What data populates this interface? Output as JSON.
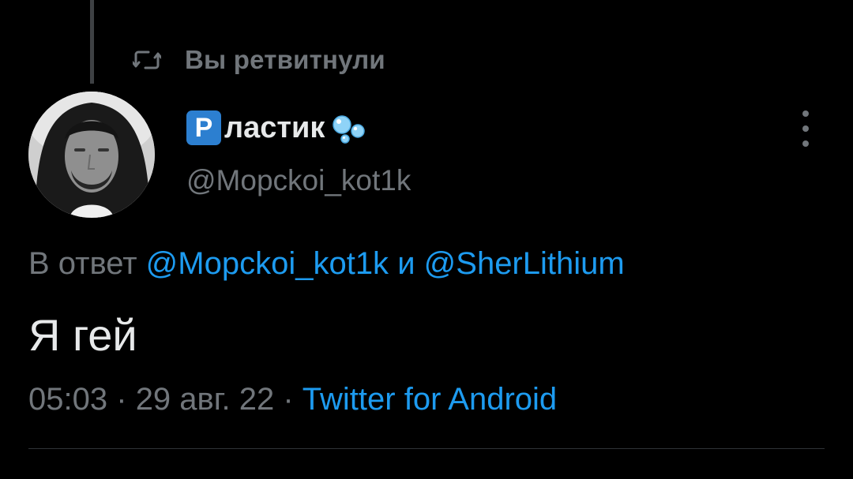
{
  "retweet": {
    "icon": "retweet-icon",
    "label": "Вы ретвитнули"
  },
  "author": {
    "name_badge": "P",
    "name_text": "ластик",
    "name_emoji_icon": "bubbles-icon",
    "handle": "@Mopckoi_kot1k",
    "avatar": "avatar"
  },
  "menu": {
    "icon": "more-vertical-icon"
  },
  "reply": {
    "prefix": "В ответ",
    "mention_1": "@Mopckoi_kot1k",
    "conjunction": "и",
    "mention_2": "@SherLithium"
  },
  "tweet": {
    "text": "Я гей"
  },
  "meta": {
    "time": "05:03",
    "separator": "·",
    "date": "29 авг. 22",
    "source": "Twitter for Android"
  },
  "colors": {
    "background": "#000000",
    "text": "#e7e9ea",
    "secondary": "#71767b",
    "link": "#1d9bf0",
    "badge": "#2c7fd0"
  }
}
